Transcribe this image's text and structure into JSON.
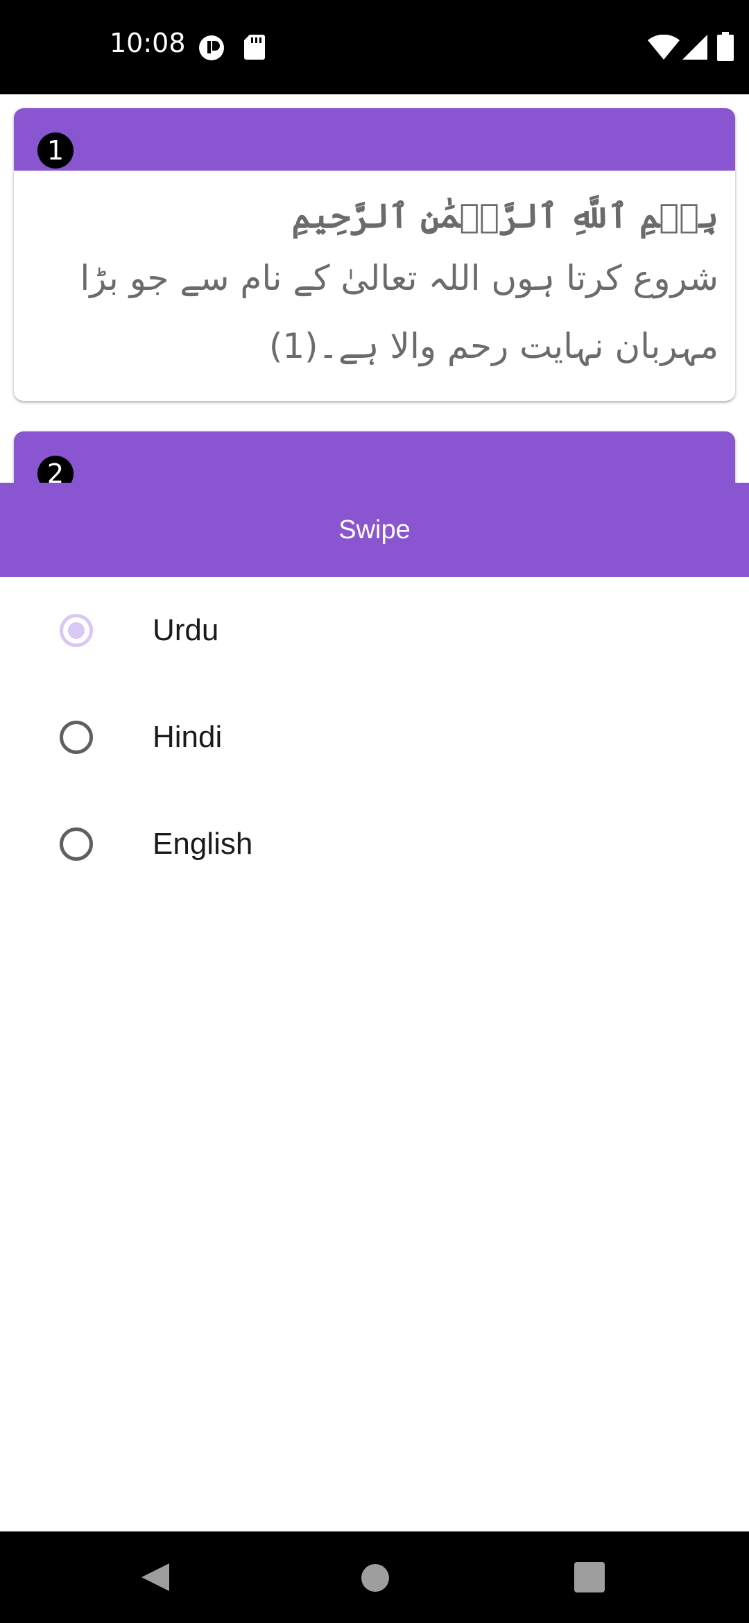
{
  "status_bar": {
    "time": "10:08"
  },
  "cards": [
    {
      "number": "1",
      "arabic": "بِسۡمِ ٱللَّهِ ٱلرَّحۡمَٰنِ ٱلرَّحِيمِ",
      "translation": "شروع کرتا ہوں اللہ تعالیٰ کے نام سے جو بڑا مہربان نہایت رحم والا ہے۔(1)"
    },
    {
      "number": "2"
    }
  ],
  "sheet": {
    "title": "Swipe",
    "options": [
      {
        "label": "Urdu",
        "selected": true
      },
      {
        "label": "Hindi",
        "selected": false
      },
      {
        "label": "English",
        "selected": false
      }
    ]
  },
  "colors": {
    "accent": "#8a55d0",
    "radio_selected": "#d9c8f3"
  },
  "icons": [
    "wifi-icon",
    "signal-icon",
    "battery-icon",
    "back-icon",
    "home-icon",
    "recents-icon"
  ]
}
